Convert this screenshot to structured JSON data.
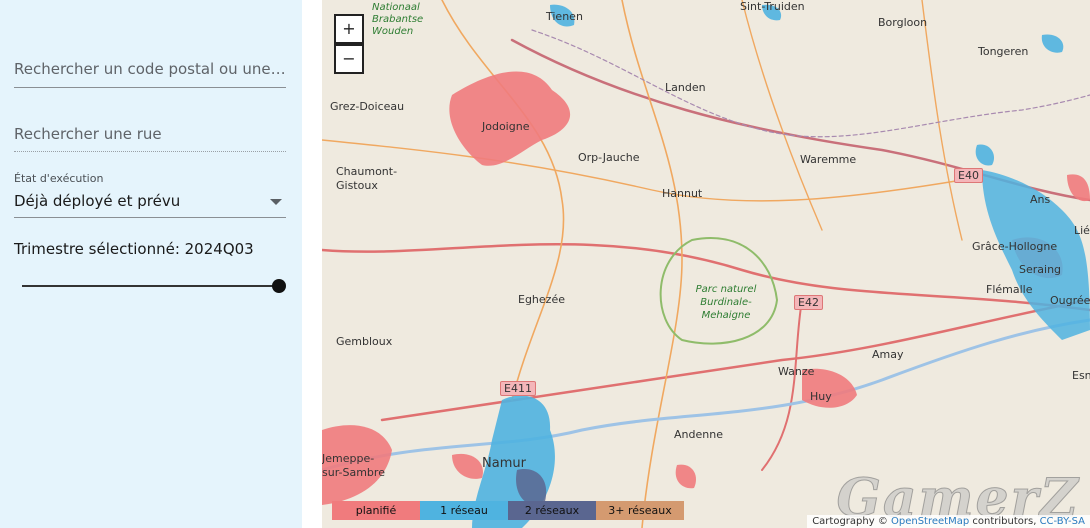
{
  "sidebar": {
    "postal_placeholder": "Rechercher un code postal ou une c...",
    "street_placeholder": "Rechercher une rue",
    "exec_label": "État d'exécution",
    "exec_value": "Déjà déployé et prévu",
    "quarter_text": "Trimestre sélectionné: 2024Q03",
    "slider_value_fraction": 1.0
  },
  "map": {
    "zoom_in": "+",
    "zoom_out": "−",
    "places": [
      "Tienen",
      "Sint-Truiden",
      "Borgloon",
      "Tongeren",
      "Grez-Doiceau",
      "Jodoigne",
      "Landen",
      "Orp-Jauche",
      "Waremme",
      "Chaumont-Gistoux",
      "Hannut",
      "Ans",
      "Grâce-Hollogne",
      "Seraing",
      "Flémalle",
      "Ougrée",
      "Eghezée",
      "Gembloux",
      "Amay",
      "Wanze",
      "Huy",
      "Andenne",
      "Namur",
      "Esn",
      "Lié",
      "Nationaal",
      "Brabantse",
      "Wouden",
      "Jemeppe-sur-Sambre"
    ],
    "park": "Parc naturel Burdinale-Mehaigne",
    "roads": [
      "E40",
      "E42",
      "E411"
    ]
  },
  "legend": [
    "planifié",
    "1 réseau",
    "2 réseaux",
    "3+ réseaux"
  ],
  "attribution": {
    "prefix": "Cartography © ",
    "osm": "OpenStreetMap",
    "middle": " contributors, ",
    "license": "CC-BY-SA"
  },
  "watermark": "GamerZ",
  "colors": {
    "planned": "#f07b7d",
    "one": "#4fb3e0",
    "two": "#5a6690",
    "three": "#d49a70",
    "sidebar": "#e5f4fc"
  }
}
